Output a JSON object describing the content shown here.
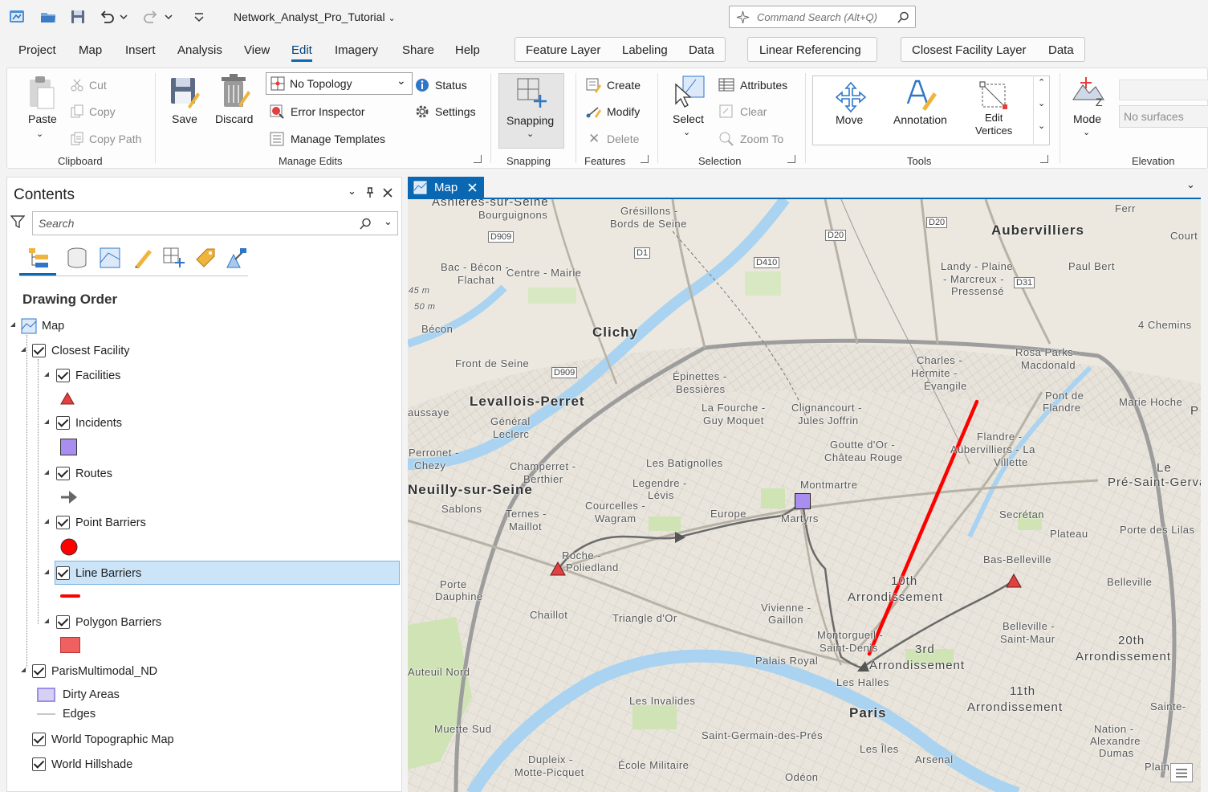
{
  "title": {
    "document": "Network_Analyst_Pro_Tutorial",
    "command_search_placeholder": "Command Search (Alt+Q)"
  },
  "menu": {
    "tabs": [
      "Project",
      "Map",
      "Insert",
      "Analysis",
      "View",
      "Edit",
      "Imagery",
      "Share",
      "Help"
    ],
    "active": "Edit",
    "context_feature_layer": [
      "Feature Layer",
      "Labeling",
      "Data"
    ],
    "context_linear": [
      "Linear Referencing"
    ],
    "context_closest": [
      "Closest Facility Layer",
      "Data"
    ]
  },
  "ribbon": {
    "clipboard": {
      "paste": "Paste",
      "cut": "Cut",
      "copy": "Copy",
      "copy_path": "Copy Path",
      "title": "Clipboard"
    },
    "manage_edits": {
      "save": "Save",
      "discard": "Discard",
      "topology": "No Topology",
      "error_inspector": "Error Inspector",
      "manage_templates": "Manage Templates",
      "status": "Status",
      "settings": "Settings",
      "title": "Manage Edits"
    },
    "snapping": {
      "label": "Snapping",
      "title": "Snapping"
    },
    "features": {
      "create": "Create",
      "modify": "Modify",
      "delete": "Delete",
      "title": "Features"
    },
    "selection": {
      "select": "Select",
      "attributes": "Attributes",
      "clear": "Clear",
      "zoom_to": "Zoom To",
      "title": "Selection"
    },
    "tools": {
      "move": "Move",
      "annotation": "Annotation",
      "edit_vertices_1": "Edit",
      "edit_vertices_2": "Vertices",
      "title": "Tools"
    },
    "elevation": {
      "mode": "Mode",
      "surface": "No surfaces",
      "title": "Elevation"
    }
  },
  "contents": {
    "title": "Contents",
    "search_placeholder": "Search",
    "section": "Drawing Order",
    "layers": {
      "map": "Map",
      "closest_facility": "Closest Facility",
      "facilities": "Facilities",
      "incidents": "Incidents",
      "routes": "Routes",
      "point_barriers": "Point Barriers",
      "line_barriers": "Line Barriers",
      "polygon_barriers": "Polygon Barriers",
      "paris_nd": "ParisMultimodal_ND",
      "dirty_areas": "Dirty Areas",
      "edges": "Edges",
      "world_topo": "World Topographic Map",
      "world_hillshade": "World Hillshade"
    }
  },
  "map": {
    "tab": "Map",
    "labels": {
      "asnieres": "Asnières-sur-Seine",
      "gresillons": "Grésillons -",
      "bords": "Bords de Seine",
      "bourguignons": "Bourguignons",
      "aubervilliers": "Aubervilliers",
      "landy": "Landy - Plaine",
      "marcreux": "- Marcreux -",
      "pressense": "Pressensé",
      "paul_bert": "Paul Bert",
      "bac": "Bac - Bécon -",
      "flachat": "Flachat",
      "centre_mairie": "Centre - Mairie",
      "becon": "Bécon",
      "clichy": "Clichy",
      "quatre_chemins": "4 Chemins",
      "front_seine": "Front de Seine",
      "levallois": "Levallois-Perret",
      "epinettes": "Épinettes -",
      "bessieres": "Bessières",
      "charles": "Charles -",
      "hermite": "Hermite -",
      "evangile": "Évangile",
      "rosa": "Rosa Parks -",
      "macdonald": "Macdonald",
      "pont_flandre": "Pont de",
      "flandre": "Flandre",
      "marie_hoche": "Marie Hoche",
      "general": "Général",
      "leclerc": "Leclerc",
      "fourche": "La Fourche -",
      "guy": "Guy Moquet",
      "clignancourt": "Clignancourt -",
      "jules": "Jules Joffrin",
      "goutte": "Goutte d'Or -",
      "chateau_rouge": "Château Rouge",
      "villette": "Flandre -",
      "aubervilliers_villette": "Aubervilliers - La",
      "villette2": "Villette",
      "le_pre": "Le",
      "pre_st_gervais": "Pré-Saint-Gervais",
      "perronet": "Perronet -",
      "chezy": "Chezy",
      "champerret": "Champerret -",
      "berthier": "Berthier",
      "batignolles": "Les Batignolles",
      "legendre": "Legendre -",
      "levis": "Lévis",
      "montmartre": "Montmartre",
      "neuilly": "Neuilly-sur-Seine",
      "sablons": "Sablons",
      "ternes": "Ternes -",
      "maillot": "Maillot",
      "courcelles": "Courcelles -",
      "wagram": "Wagram",
      "europe": "Europe",
      "martyrs": "Martyrs",
      "secretan": "Secrétan",
      "plateau": "Plateau",
      "porte_lilas": "Porte des Lilas",
      "roche": "Roche -",
      "poliedland": "Poliedland",
      "porte_dauphine": "Porte",
      "dauphine": "Dauphine",
      "tenth": "10th",
      "tenth_arr": "Arrondissement",
      "bas_belleville": "Bas-Belleville",
      "belleville": "Belleville",
      "chaillot": "Chaillot",
      "triangle": "Triangle d'Or",
      "vivienne": "Vivienne -",
      "gaillon": "Gaillon",
      "montorgueil": "Montorgueil -",
      "saint_denis": "Saint-Denis",
      "belleville2": "Belleville -",
      "saint_maur": "Saint-Maur",
      "twentieth": "20th",
      "twentieth_arr": "Arrondissement",
      "palais_royal": "Palais Royal",
      "third": "3rd",
      "third_arr": "Arrondissement",
      "halles": "Les Halles",
      "eleventh": "11th",
      "eleventh_arr": "Arrondissement",
      "auteuil_nord": "Auteuil Nord",
      "invalides": "Les Invalides",
      "paris": "Paris",
      "sainte": "Sainte-",
      "muette": "Muette Sud",
      "st_germain": "Saint-Germain-des-Prés",
      "iles": "Les Îles",
      "nation": "Nation -",
      "alexandre": "Alexandre",
      "dumas": "Dumas",
      "dupleix": "Dupleix -",
      "motte": "Motte-Picquet",
      "ecole": "École Militaire",
      "arsenal": "Arsenal",
      "odeon": "Odéon",
      "plaine": "Plaine",
      "aussaye": "aussaye",
      "court": "Court",
      "fert": "Ferr",
      "p_edge": "P",
      "d909": "D909",
      "d909b": "D909",
      "d1": "D1",
      "d20": "D20",
      "d20b": "D20",
      "d410": "D410",
      "d31": "D31",
      "m45": "45 m",
      "m50": "50 m"
    }
  },
  "colors": {
    "accent": "#0a67b2",
    "facility": "#e04040",
    "incident": "#a98ef0",
    "route": "#555555",
    "point_barrier": "#ff0000",
    "line_barrier": "#ff0000",
    "polygon_barrier": "#f06060",
    "selected_row": "#cce4f7"
  }
}
